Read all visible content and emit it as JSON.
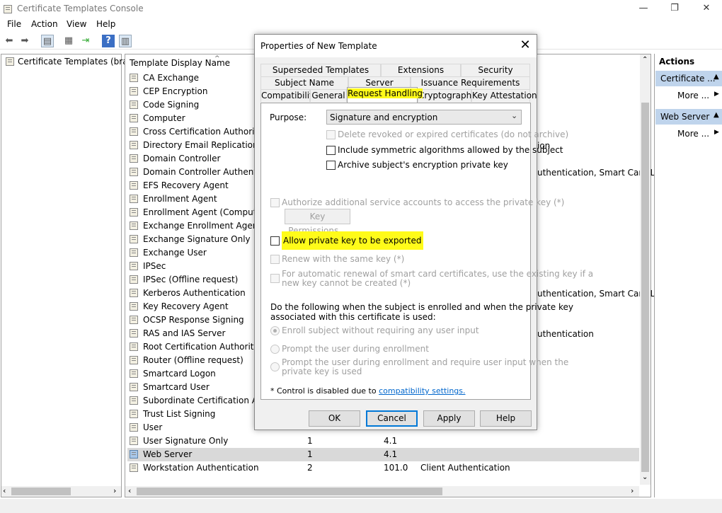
{
  "window": {
    "title": "Certificate Templates Console",
    "minimize": "—",
    "restore": "❐",
    "close": "✕"
  },
  "menu": [
    "File",
    "Action",
    "View",
    "Help"
  ],
  "tree": {
    "item": "Certificate Templates (brain"
  },
  "list": {
    "column_header": "Template Display Name",
    "sort_arrow": "^",
    "rows": [
      {
        "name": "CA Exchange"
      },
      {
        "name": "CEP Encryption"
      },
      {
        "name": "Code Signing"
      },
      {
        "name": "Computer"
      },
      {
        "name": "Cross Certification Authority"
      },
      {
        "name": "Directory Email Replication"
      },
      {
        "name": "Domain Controller"
      },
      {
        "name": "Domain Controller Authenticati"
      },
      {
        "name": "EFS Recovery Agent"
      },
      {
        "name": "Enrollment Agent"
      },
      {
        "name": "Enrollment Agent (Computer)"
      },
      {
        "name": "Exchange Enrollment Agent (O"
      },
      {
        "name": "Exchange Signature Only"
      },
      {
        "name": "Exchange User"
      },
      {
        "name": "IPSec"
      },
      {
        "name": "IPSec (Offline request)"
      },
      {
        "name": "Kerberos Authentication"
      },
      {
        "name": "Key Recovery Agent"
      },
      {
        "name": "OCSP Response Signing"
      },
      {
        "name": "RAS and IAS Server"
      },
      {
        "name": "Root Certification Authority"
      },
      {
        "name": "Router (Offline request)"
      },
      {
        "name": "Smartcard Logon"
      },
      {
        "name": "Smartcard User"
      },
      {
        "name": "Subordinate Certification Auth"
      },
      {
        "name": "Trust List Signing"
      },
      {
        "name": "User"
      },
      {
        "name": "User Signature Only",
        "schema": "1",
        "version": "4.1",
        "purposes": ""
      },
      {
        "name": "Web Server",
        "schema": "1",
        "version": "4.1",
        "purposes": ""
      },
      {
        "name": "Workstation Authentication",
        "schema": "2",
        "version": "101.0",
        "purposes": "Client Authentication"
      }
    ],
    "visible_fragments": {
      "dir_email": "ion",
      "dc_auth": "uthentication, Smart Card Lo",
      "kerberos": "uthentication, Smart Card Lo",
      "ras": "uthentication"
    }
  },
  "actions": {
    "title": "Actions",
    "sections": [
      {
        "label": "Certificate ...",
        "more": "More ..."
      },
      {
        "label": "Web Server",
        "more": "More ..."
      }
    ]
  },
  "dialog": {
    "title": "Properties of New Template",
    "close": "✕",
    "tabs_row1": [
      "Superseded Templates",
      "Extensions",
      "Security"
    ],
    "tabs_row2": [
      "Subject Name",
      "Server",
      "Issuance Requirements"
    ],
    "tabs_row3": [
      "Compatibility",
      "General",
      "Request Handling",
      "Cryptography",
      "Key Attestation"
    ],
    "active_tab": "Request Handling",
    "purpose_label": "Purpose:",
    "purpose_value": "Signature and encryption",
    "opt_delete_revoked": "Delete revoked or expired certificates (do not archive)",
    "opt_symmetric": "Include symmetric algorithms allowed by the subject",
    "opt_archive": "Archive subject's encryption private key",
    "opt_authorize": "Authorize additional service accounts to access the private key (*)",
    "btn_key_permissions": "Key Permissions...",
    "opt_allow_export": "Allow private key to be exported",
    "opt_renew_same": "Renew with the same key (*)",
    "opt_smartcard_line1": "For automatic renewal of smart card certificates, use the existing key if a",
    "opt_smartcard_line2": "new key cannot be created (*)",
    "enroll_prompt_line1": "Do the following when the subject is enrolled and when the private key",
    "enroll_prompt_line2": "associated with this certificate is used:",
    "radio_enroll_no_input": "Enroll subject without requiring any user input",
    "radio_prompt_user": "Prompt the user during enrollment",
    "radio_prompt_require_line1": "Prompt the user during enrollment and require user input when the",
    "radio_prompt_require_line2": "private key is used",
    "footnote_prefix": "* Control is disabled due to ",
    "footnote_link": "compatibility settings.",
    "btn_ok": "OK",
    "btn_cancel": "Cancel",
    "btn_apply": "Apply",
    "btn_help": "Help"
  },
  "colors": {
    "highlight": "#fffb1a",
    "selected_row": "#d9d9d9",
    "actions_section": "#bfd4ec",
    "link": "#0066cc"
  }
}
